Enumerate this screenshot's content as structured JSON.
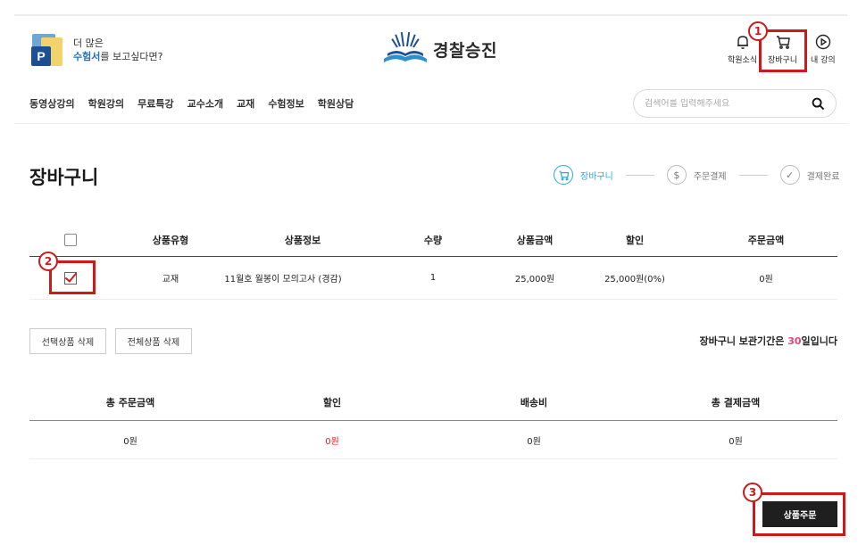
{
  "header": {
    "promo_line1": "더 많은",
    "promo_highlight": "수험서",
    "promo_line2_rest": "를 보고싶다면?",
    "promo_book_letter": "P",
    "logo_text": "경찰승진",
    "util": {
      "news_label": "학원소식",
      "cart_label": "장바구니",
      "my_label": "내 강의"
    }
  },
  "nav": {
    "items": [
      "동영상강의",
      "학원강의",
      "무료특강",
      "교수소개",
      "교재",
      "수험정보",
      "학원상담"
    ]
  },
  "search": {
    "placeholder": "검색어를 입력해주세요"
  },
  "page": {
    "title": "장바구니",
    "steps": [
      {
        "label": "장바구니",
        "icon": "cart-icon",
        "active": true
      },
      {
        "label": "주문결제",
        "icon": "dollar-icon",
        "active": false
      },
      {
        "label": "결제완료",
        "icon": "check-icon",
        "active": false
      }
    ]
  },
  "cart_table": {
    "headers": [
      "상품유형",
      "상품정보",
      "수량",
      "상품금액",
      "할인",
      "주문금액"
    ],
    "rows": [
      {
        "checked": true,
        "type": "교재",
        "info": "11월호 월봉이 모의고사 (경감)",
        "qty": "1",
        "price": "25,000원",
        "discount": "25,000원(0%)",
        "order_amount": "0원"
      }
    ]
  },
  "actions": {
    "delete_selected": "선택상품 삭제",
    "delete_all": "전체상품 삭제",
    "keep_prefix": "장바구니 보관기간은 ",
    "keep_days": "30",
    "keep_suffix": "일입니다"
  },
  "summary": {
    "headers": [
      "총 주문금액",
      "할인",
      "배송비",
      "총 결제금액"
    ],
    "values": [
      "0원",
      "0원",
      "0원",
      "0원"
    ]
  },
  "order_button": "상품주문",
  "annotations": [
    "1",
    "2",
    "3"
  ],
  "colors": {
    "accent": "#2aa7d8",
    "annotation": "#cc1a1a",
    "discount_red": "#e02020",
    "keep_days": "#e6457a",
    "order_button_bg": "#1f1f1f"
  }
}
